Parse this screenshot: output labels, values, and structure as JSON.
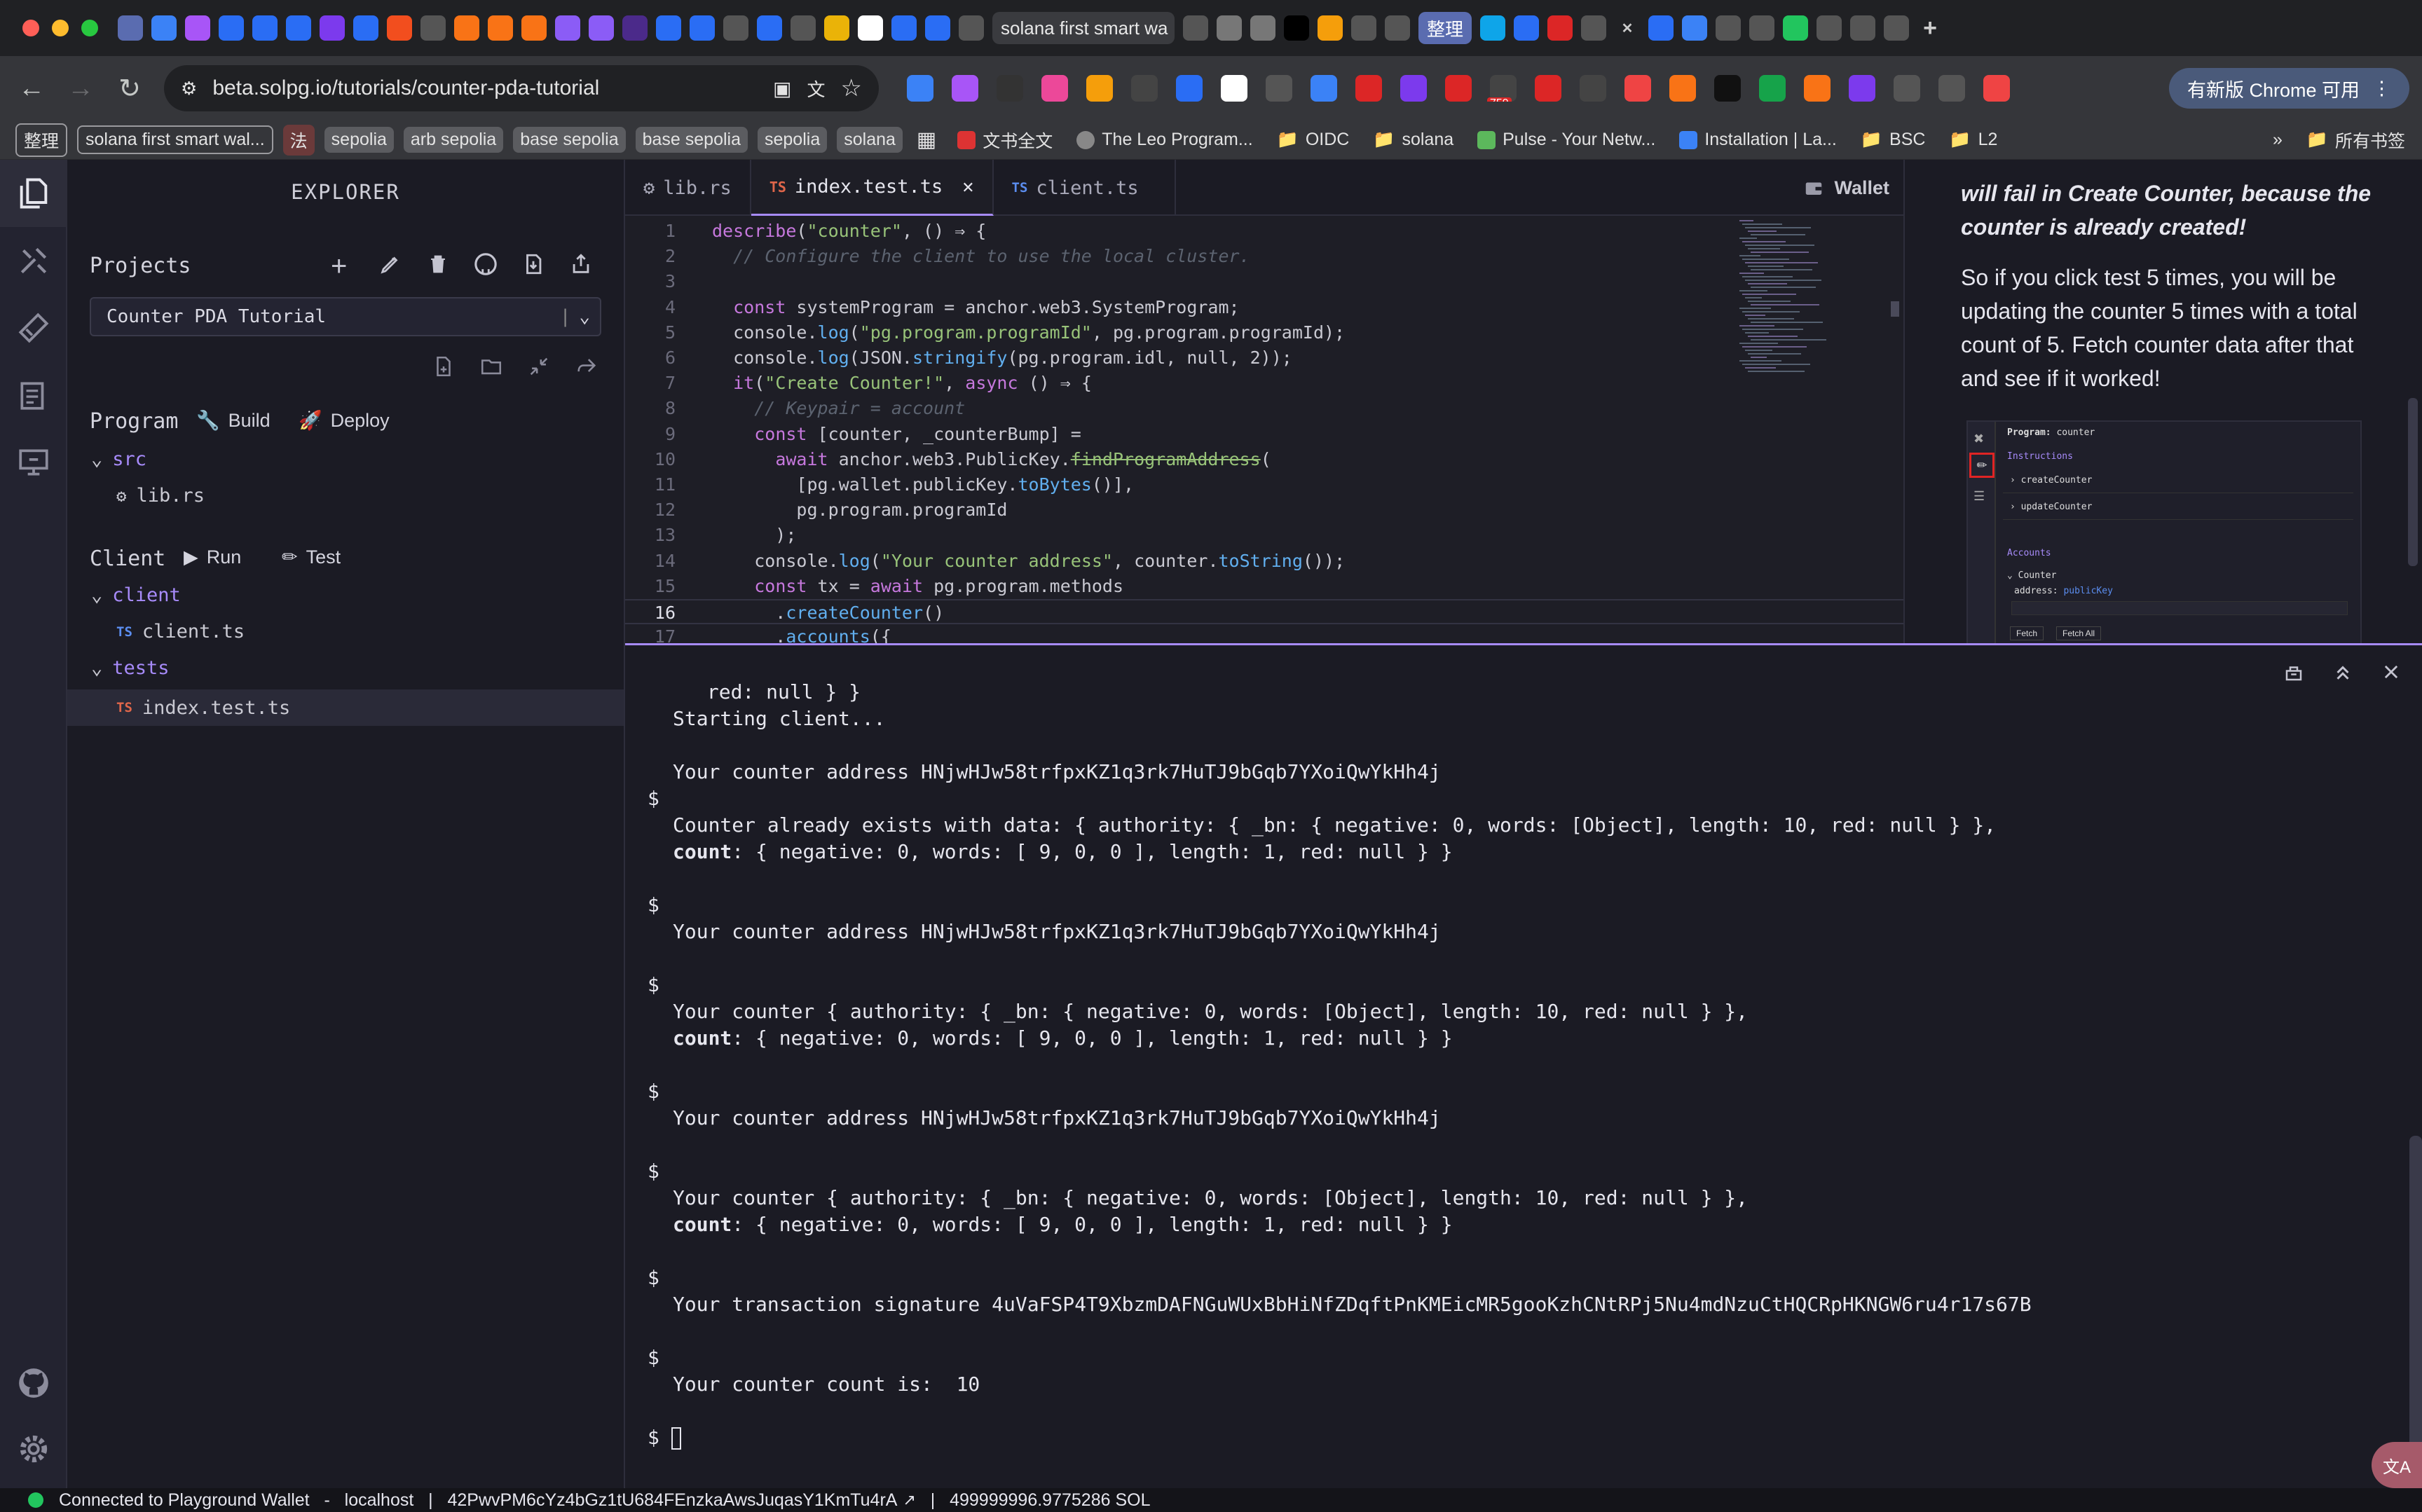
{
  "browser": {
    "tab_search_text": "solana first smart wa",
    "tab_group_label": "整理",
    "url": "beta.solpg.io/tutorials/counter-pda-tutorial",
    "ext_badge": "759",
    "update_button": "有新版 Chrome 可用",
    "bookmarks": [
      "整理",
      "solana first smart wal...",
      "法",
      "sepolia",
      "arb sepolia",
      "base sepolia",
      "base sepolia",
      "sepolia",
      "solana",
      "文书全文",
      "The Leo Program...",
      "OIDC",
      "solana",
      "Pulse - Your Netw...",
      "Installation | La...",
      "BSC",
      "L2",
      "所有书签"
    ]
  },
  "explorer": {
    "title": "EXPLORER",
    "projects_label": "Projects",
    "project_selected": "Counter PDA Tutorial",
    "program_label": "Program",
    "build_label": "Build",
    "deploy_label": "Deploy",
    "src_folder": "src",
    "lib_file": "lib.rs",
    "client_label": "Client",
    "run_label": "Run",
    "test_label": "Test",
    "client_folder": "client",
    "client_file": "client.ts",
    "tests_folder": "tests",
    "test_file": "index.test.ts",
    "ts_badge": "TS"
  },
  "editor": {
    "tabs": [
      {
        "label": "lib.rs",
        "icon": "rust-icon"
      },
      {
        "label": "index.test.ts",
        "icon": "ts-icon",
        "active": true
      },
      {
        "label": "client.ts",
        "icon": "ts-icon"
      }
    ],
    "wallet_label": "Wallet",
    "current_line": 16,
    "lines": [
      {
        "n": "1",
        "code": "describe(\"counter\", () ⇒ {"
      },
      {
        "n": "2",
        "code": "  // Configure the client to use the local cluster."
      },
      {
        "n": "3",
        "code": ""
      },
      {
        "n": "4",
        "code": "  const systemProgram = anchor.web3.SystemProgram;"
      },
      {
        "n": "5",
        "code": "  console.log(\"pg.program.programId\", pg.program.programId);"
      },
      {
        "n": "6",
        "code": "  console.log(JSON.stringify(pg.program.idl, null, 2));"
      },
      {
        "n": "7",
        "code": "  it(\"Create Counter!\", async () ⇒ {"
      },
      {
        "n": "8",
        "code": "    // Keypair = account"
      },
      {
        "n": "9",
        "code": "    const [counter, _counterBump] ="
      },
      {
        "n": "10",
        "code": "      await anchor.web3.PublicKey.findProgramAddress("
      },
      {
        "n": "11",
        "code": "        [pg.wallet.publicKey.toBytes()],"
      },
      {
        "n": "12",
        "code": "        pg.program.programId"
      },
      {
        "n": "13",
        "code": "      );"
      },
      {
        "n": "14",
        "code": "    console.log(\"Your counter address\", counter.toString());"
      },
      {
        "n": "15",
        "code": "    const tx = await pg.program.methods"
      },
      {
        "n": "16",
        "code": "      .createCounter()"
      },
      {
        "n": "17",
        "code": "      .accounts({"
      }
    ]
  },
  "tutorial": {
    "para1": "will fail in Create Counter, because the counter is already created!",
    "para2": "So if you click test 5 times, you will be updating the counter 5 times with a total count of 5. Fetch counter data after that and see if it worked!",
    "shot": {
      "program_label": "Program:",
      "program_name": "counter",
      "instructions": "Instructions",
      "items": [
        "createCounter",
        "updateCounter"
      ],
      "accounts": "Accounts",
      "counter": "Counter",
      "address_label": "address:",
      "address_value": "publicKey",
      "fetch": "Fetch",
      "fetch_all": "Fetch All"
    }
  },
  "terminal": {
    "lines": [
      {
        "text": "   red: null } }"
      },
      {
        "text": "  Starting client..."
      },
      {
        "text": ""
      },
      {
        "text": "  Your counter address HNjwHJw58trfpxKZ1q3rk7HuTJ9bGqb7YXoiQwYkHh4j"
      },
      {
        "text": "$"
      },
      {
        "text": "  Counter already exists with data: { authority: { _bn: { negative: 0, words: [Object], length: 10, red: null } },"
      },
      {
        "bold": "count",
        "text": ": { negative: 0, words: [ 9, 0, 0 ], length: 1, red: null } }"
      },
      {
        "text": ""
      },
      {
        "text": "$"
      },
      {
        "text": "  Your counter address HNjwHJw58trfpxKZ1q3rk7HuTJ9bGqb7YXoiQwYkHh4j"
      },
      {
        "text": ""
      },
      {
        "text": "$"
      },
      {
        "text": "  Your counter { authority: { _bn: { negative: 0, words: [Object], length: 10, red: null } },"
      },
      {
        "bold": "count",
        "text": ": { negative: 0, words: [ 9, 0, 0 ], length: 1, red: null } }"
      },
      {
        "text": ""
      },
      {
        "text": "$"
      },
      {
        "text": "  Your counter address HNjwHJw58trfpxKZ1q3rk7HuTJ9bGqb7YXoiQwYkHh4j"
      },
      {
        "text": ""
      },
      {
        "text": "$"
      },
      {
        "text": "  Your counter { authority: { _bn: { negative: 0, words: [Object], length: 10, red: null } },"
      },
      {
        "bold": "count",
        "text": ": { negative: 0, words: [ 9, 0, 0 ], length: 1, red: null } }"
      },
      {
        "text": ""
      },
      {
        "text": "$"
      },
      {
        "text": "  Your transaction signature 4uVaFSP4T9XbzmDAFNGuWUxBbHiNfZDqftPnKMEicMR5gooKzhCNtRPj5Nu4mdNzuCtHQCRpHKNGW6ru4r17s67B"
      },
      {
        "text": ""
      },
      {
        "text": "$"
      },
      {
        "text": "  Your counter count is:  10"
      },
      {
        "text": ""
      },
      {
        "text": "$ "
      }
    ]
  },
  "translate_label": "文A",
  "status": {
    "connection": "Connected to Playground Wallet",
    "sep": "-",
    "network": "localhost",
    "bar": "|",
    "address": "42PwvPM6cYz4bGz1tU684FEnzkaAwsJuqasY1KmTu4rA",
    "balance": "499999996.9775286 SOL"
  }
}
